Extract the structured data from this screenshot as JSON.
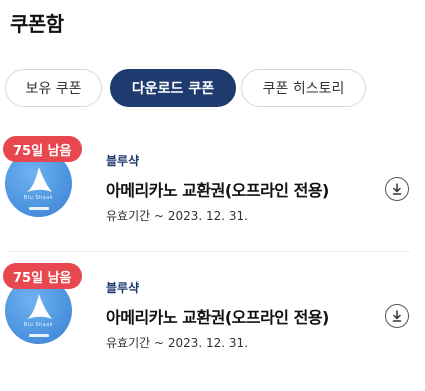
{
  "header": {
    "title": "쿠폰함"
  },
  "tabs": [
    {
      "label": "보유 쿠폰",
      "active": false
    },
    {
      "label": "다운로드 쿠폰",
      "active": true
    },
    {
      "label": "쿠폰 히스토리",
      "active": false
    }
  ],
  "colors": {
    "accent": "#1e3a6e",
    "badge": "#e8474f",
    "thumb": "#4d94e0"
  },
  "coupons": [
    {
      "badge": "75일 남음",
      "brand": "블루샥",
      "name": "아메리카노 교환권(오프라인 전용)",
      "validity": "유효기간 ~ 2023. 12. 31.",
      "logo_text": "Blu Shaak",
      "action_icon": "download-icon"
    },
    {
      "badge": "75일 남음",
      "brand": "블루샥",
      "name": "아메리카노 교환권(오프라인 전용)",
      "validity": "유효기간 ~ 2023. 12. 31.",
      "logo_text": "Blu Shaak",
      "action_icon": "download-icon"
    }
  ]
}
